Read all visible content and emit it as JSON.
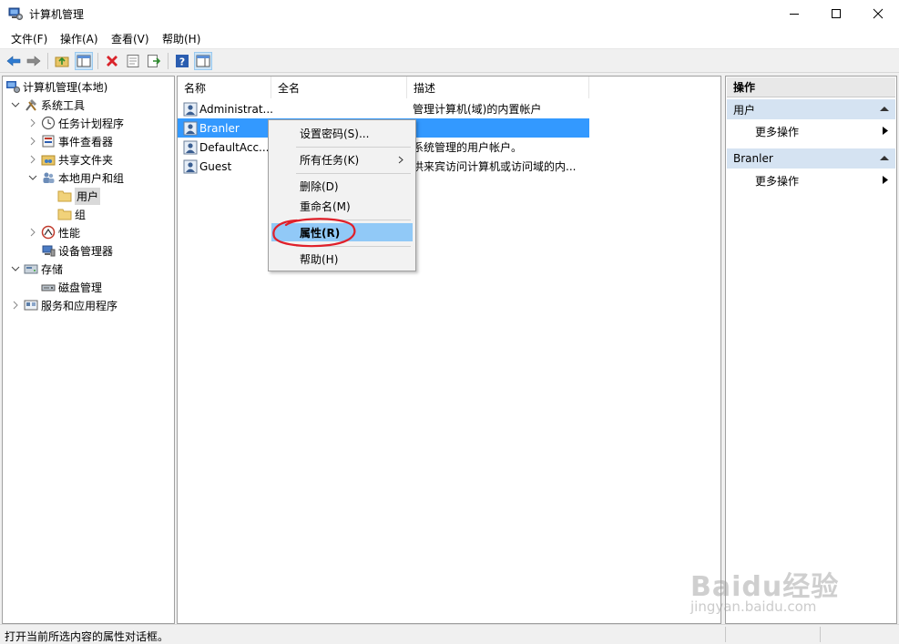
{
  "window": {
    "title": "计算机管理",
    "icon": "computer-management-icon"
  },
  "menubar": {
    "items": [
      "文件(F)",
      "操作(A)",
      "查看(V)",
      "帮助(H)"
    ]
  },
  "toolbar": {
    "buttons": [
      "back-arrow-icon",
      "forward-arrow-icon",
      "up-folder-icon",
      "show-hide-console-tree-icon",
      "delete-icon",
      "properties-icon",
      "export-list-icon",
      "help-icon",
      "show-hide-action-pane-icon"
    ]
  },
  "tree": {
    "root": "计算机管理(本地)",
    "items": [
      {
        "label": "系统工具",
        "icon": "tools-icon"
      },
      {
        "label": "任务计划程序",
        "icon": "clock-icon"
      },
      {
        "label": "事件查看器",
        "icon": "event-viewer-icon"
      },
      {
        "label": "共享文件夹",
        "icon": "shared-folder-icon"
      },
      {
        "label": "本地用户和组",
        "icon": "users-group-icon"
      },
      {
        "label": "用户",
        "icon": "folder-icon"
      },
      {
        "label": "组",
        "icon": "folder-icon"
      },
      {
        "label": "性能",
        "icon": "performance-icon"
      },
      {
        "label": "设备管理器",
        "icon": "device-manager-icon"
      },
      {
        "label": "存储",
        "icon": "storage-icon"
      },
      {
        "label": "磁盘管理",
        "icon": "disk-management-icon"
      },
      {
        "label": "服务和应用程序",
        "icon": "services-icon"
      }
    ]
  },
  "list": {
    "columns": [
      "名称",
      "全名",
      "描述"
    ],
    "rows": [
      {
        "name": "Administrat...",
        "fullname": "",
        "description": "管理计算机(域)的内置帐户"
      },
      {
        "name": "Branler",
        "fullname": "",
        "description": ""
      },
      {
        "name": "DefaultAcc...",
        "fullname": "",
        "description": "系统管理的用户帐户。"
      },
      {
        "name": "Guest",
        "fullname": "",
        "description": "供来宾访问计算机或访问域的内..."
      }
    ]
  },
  "context_menu": {
    "items": [
      "设置密码(S)...",
      "所有任务(K)",
      "删除(D)",
      "重命名(M)",
      "属性(R)",
      "帮助(H)"
    ],
    "highlighted": "属性(R)"
  },
  "actions": {
    "header": "操作",
    "sections": [
      {
        "title": "用户",
        "item": "更多操作"
      },
      {
        "title": "Branler",
        "item": "更多操作"
      }
    ]
  },
  "statusbar": {
    "text": "打开当前所选内容的属性对话框。"
  },
  "watermark": {
    "brand": "Baidu经验",
    "url": "jingyan.baidu.com"
  },
  "colors": {
    "selection": "#3399ff",
    "menu_highlight": "#91c9f7",
    "annotation": "#e0202a",
    "action_section": "#d5e3f2"
  }
}
